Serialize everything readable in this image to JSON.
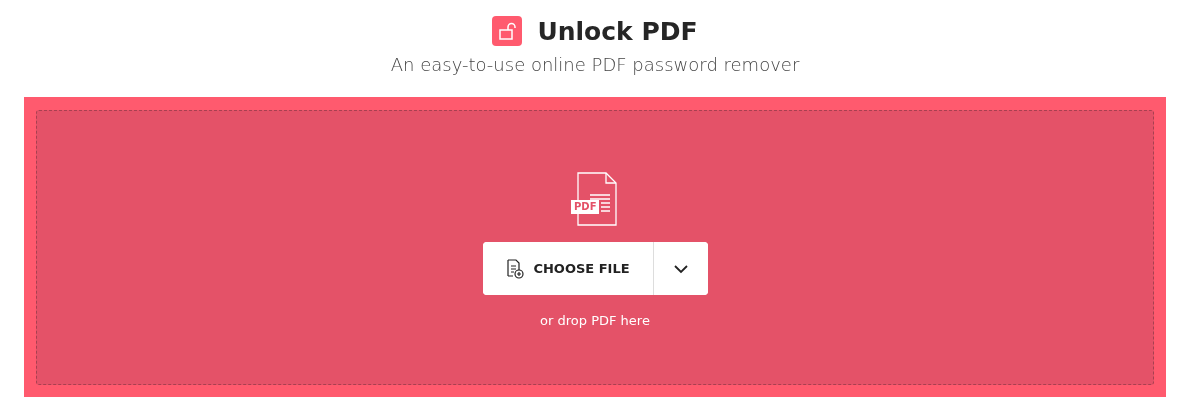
{
  "header": {
    "title": "Unlock PDF",
    "subtitle": "An easy-to-use online PDF password remover"
  },
  "dropzone": {
    "file_badge": "PDF",
    "choose_button": "CHOOSE FILE",
    "drop_hint": "or drop PDF here"
  }
}
